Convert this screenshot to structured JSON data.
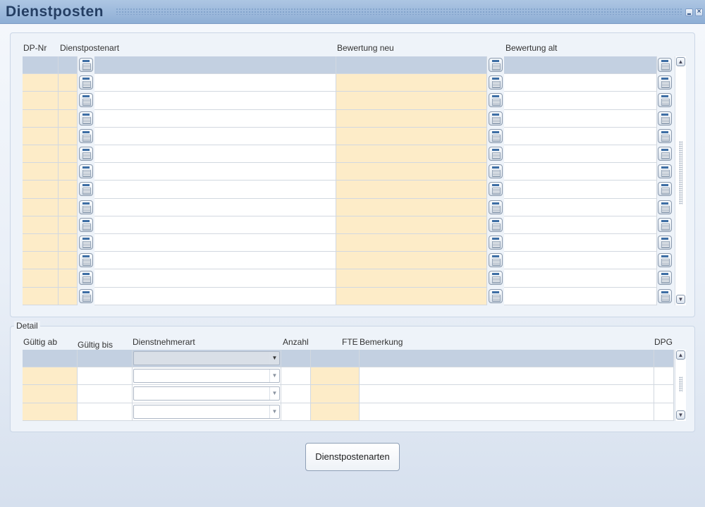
{
  "window": {
    "title": "Dienstposten"
  },
  "master": {
    "headers": {
      "dp_nr": "DP-Nr",
      "dienstpostenart": "Dienstpostenart",
      "bewertung_neu": "Bewertung neu",
      "bewertung_alt": "Bewertung alt"
    },
    "row_count": 14,
    "rows": [
      {
        "dp_nr": "",
        "dienstpostenart": "",
        "bewertung_neu": "",
        "bewertung_alt": ""
      },
      {
        "dp_nr": "",
        "dienstpostenart": "",
        "bewertung_neu": "",
        "bewertung_alt": ""
      },
      {
        "dp_nr": "",
        "dienstpostenart": "",
        "bewertung_neu": "",
        "bewertung_alt": ""
      },
      {
        "dp_nr": "",
        "dienstpostenart": "",
        "bewertung_neu": "",
        "bewertung_alt": ""
      },
      {
        "dp_nr": "",
        "dienstpostenart": "",
        "bewertung_neu": "",
        "bewertung_alt": ""
      },
      {
        "dp_nr": "",
        "dienstpostenart": "",
        "bewertung_neu": "",
        "bewertung_alt": ""
      },
      {
        "dp_nr": "",
        "dienstpostenart": "",
        "bewertung_neu": "",
        "bewertung_alt": ""
      },
      {
        "dp_nr": "",
        "dienstpostenart": "",
        "bewertung_neu": "",
        "bewertung_alt": ""
      },
      {
        "dp_nr": "",
        "dienstpostenart": "",
        "bewertung_neu": "",
        "bewertung_alt": ""
      },
      {
        "dp_nr": "",
        "dienstpostenart": "",
        "bewertung_neu": "",
        "bewertung_alt": ""
      },
      {
        "dp_nr": "",
        "dienstpostenart": "",
        "bewertung_neu": "",
        "bewertung_alt": ""
      },
      {
        "dp_nr": "",
        "dienstpostenart": "",
        "bewertung_neu": "",
        "bewertung_alt": ""
      },
      {
        "dp_nr": "",
        "dienstpostenart": "",
        "bewertung_neu": "",
        "bewertung_alt": ""
      },
      {
        "dp_nr": "",
        "dienstpostenart": "",
        "bewertung_neu": "",
        "bewertung_alt": ""
      }
    ]
  },
  "detail": {
    "legend": "Detail",
    "headers": {
      "gueltig_ab": "Gültig ab",
      "gueltig_bis": "Gültig bis",
      "dienstnehmerart": "Dienstnehmerart",
      "anzahl": "Anzahl",
      "fte": "FTE",
      "bemerkung": "Bemerkung",
      "dpg": "DPG"
    },
    "rows": [
      {
        "gueltig_ab": "",
        "gueltig_bis": "",
        "dienstnehmerart": "",
        "anzahl": "",
        "fte": "",
        "bemerkung": "",
        "dpg": ""
      },
      {
        "gueltig_ab": "",
        "gueltig_bis": "",
        "dienstnehmerart": "",
        "anzahl": "",
        "fte": "",
        "bemerkung": "",
        "dpg": ""
      },
      {
        "gueltig_ab": "",
        "gueltig_bis": "",
        "dienstnehmerart": "",
        "anzahl": "",
        "fte": "",
        "bemerkung": "",
        "dpg": ""
      },
      {
        "gueltig_ab": "",
        "gueltig_bis": "",
        "dienstnehmerart": "",
        "anzahl": "",
        "fte": "",
        "bemerkung": "",
        "dpg": ""
      }
    ]
  },
  "buttons": {
    "dienstpostenarten": "Dienstpostenarten"
  },
  "icons": {
    "lov": "list-of-values-icon",
    "scroll_up": "arrow-up-icon",
    "scroll_down": "arrow-down-icon",
    "dropdown": "chevron-down-icon",
    "minimize": "minimize-icon",
    "close": "close-icon"
  },
  "colors": {
    "titlebar": "#9bb8dc",
    "title_text": "#243e63",
    "current_row": "#c3d0e1",
    "required_field": "#fdecc8",
    "field": "#ffffff"
  }
}
